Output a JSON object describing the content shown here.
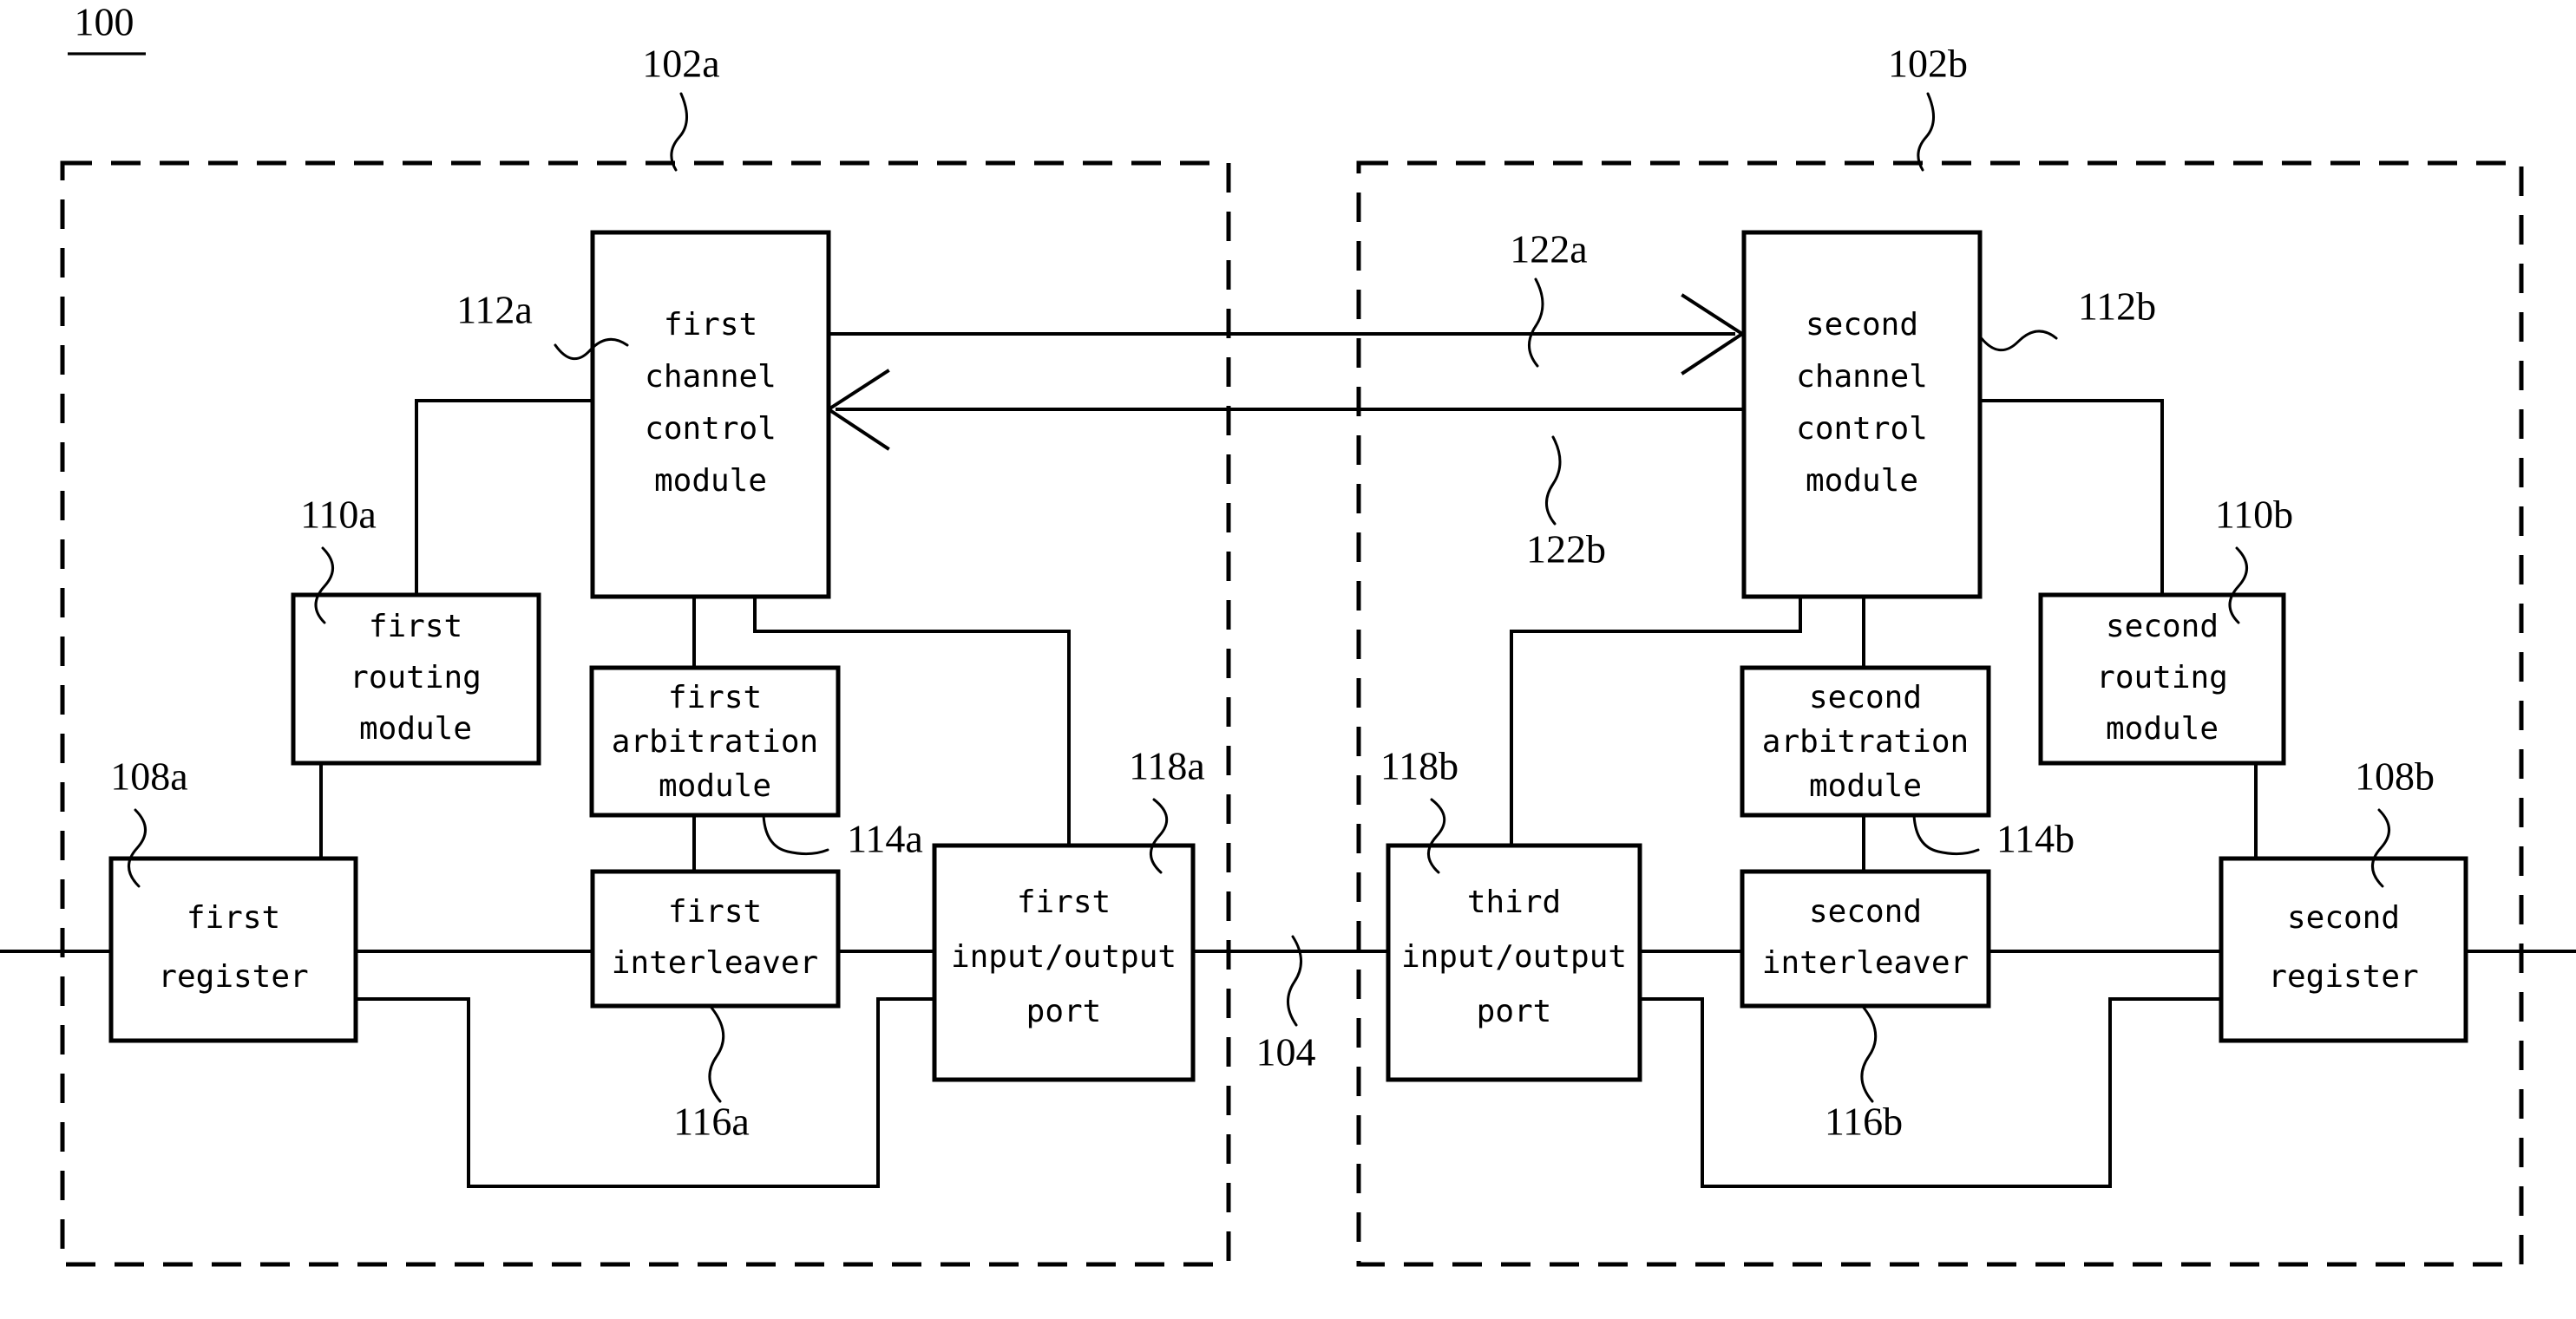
{
  "figure": {
    "id_label": "100",
    "id_underlined": true
  },
  "boundaries": [
    {
      "name": "first-node-boundary",
      "ref": "102a"
    },
    {
      "name": "second-node-boundary",
      "ref": "102b"
    }
  ],
  "link": {
    "ref": "104",
    "name": "inter-node-link"
  },
  "arrows": [
    {
      "ref": "122a",
      "direction": "left-to-right",
      "name": "forward-channel-arrow"
    },
    {
      "ref": "122b",
      "direction": "right-to-left",
      "name": "reverse-channel-arrow"
    }
  ],
  "blocks": [
    {
      "key": "ccm_a",
      "ref": "112a",
      "lines": [
        "first",
        "channel",
        "control",
        "module"
      ]
    },
    {
      "key": "rout_a",
      "ref": "110a",
      "lines": [
        "first",
        "routing",
        "module"
      ]
    },
    {
      "key": "arb_a",
      "ref": "114a",
      "lines": [
        "first",
        "arbitration",
        "module"
      ]
    },
    {
      "key": "reg_a",
      "ref": "108a",
      "lines": [
        "first",
        "register"
      ]
    },
    {
      "key": "int_a",
      "ref": "116a",
      "lines": [
        "first",
        "interleaver"
      ]
    },
    {
      "key": "io_a",
      "ref": "118a",
      "lines": [
        "first",
        "input/output",
        "port"
      ]
    },
    {
      "key": "ccm_b",
      "ref": "112b",
      "lines": [
        "second",
        "channel",
        "control",
        "module"
      ]
    },
    {
      "key": "rout_b",
      "ref": "110b",
      "lines": [
        "second",
        "routing",
        "module"
      ]
    },
    {
      "key": "arb_b",
      "ref": "114b",
      "lines": [
        "second",
        "arbitration",
        "module"
      ]
    },
    {
      "key": "reg_b",
      "ref": "108b",
      "lines": [
        "second",
        "register"
      ]
    },
    {
      "key": "int_b",
      "ref": "116b",
      "lines": [
        "second",
        "interleaver"
      ]
    },
    {
      "key": "io_b",
      "ref": "118b",
      "lines": [
        "third",
        "input/output",
        "port"
      ]
    }
  ],
  "text": {
    "ccm_a": {
      "l0": "first",
      "l1": "channel",
      "l2": "control",
      "l3": "module"
    },
    "rout_a": {
      "l0": "first",
      "l1": "routing",
      "l2": "module"
    },
    "arb_a": {
      "l0": "first",
      "l1": "arbitration",
      "l2": "module"
    },
    "reg_a": {
      "l0": "first",
      "l1": "register"
    },
    "int_a": {
      "l0": "first",
      "l1": "interleaver"
    },
    "io_a": {
      "l0": "first",
      "l1": "input/output",
      "l2": "port"
    },
    "ccm_b": {
      "l0": "second",
      "l1": "channel",
      "l2": "control",
      "l3": "module"
    },
    "rout_b": {
      "l0": "second",
      "l1": "routing",
      "l2": "module"
    },
    "arb_b": {
      "l0": "second",
      "l1": "arbitration",
      "l2": "module"
    },
    "reg_b": {
      "l0": "second",
      "l1": "register"
    },
    "int_b": {
      "l0": "second",
      "l1": "interleaver"
    },
    "io_b": {
      "l0": "third",
      "l1": "input/output",
      "l2": "port"
    }
  },
  "refs": {
    "fig": "100",
    "n102a": "102a",
    "n102b": "102b",
    "n104": "104",
    "n108a": "108a",
    "n108b": "108b",
    "n110a": "110a",
    "n110b": "110b",
    "n112a": "112a",
    "n112b": "112b",
    "n114a": "114a",
    "n114b": "114b",
    "n116a": "116a",
    "n116b": "116b",
    "n118a": "118a",
    "n118b": "118b",
    "n122a": "122a",
    "n122b": "122b"
  },
  "colors": {
    "stroke": "#000000",
    "background": "#ffffff"
  }
}
